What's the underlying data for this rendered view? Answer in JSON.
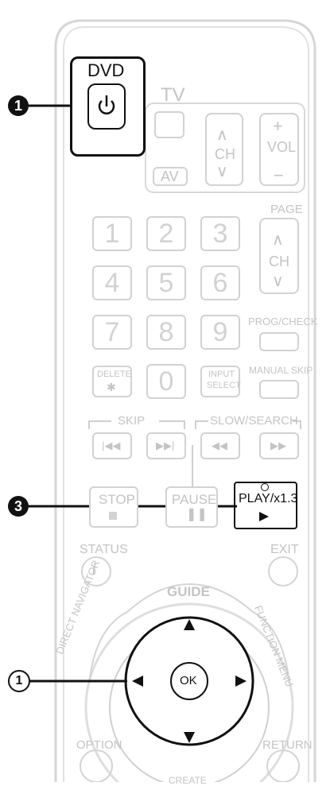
{
  "callouts": {
    "c1": "1",
    "c3": "3",
    "c_circle": "1"
  },
  "dvd": {
    "label": "DVD"
  },
  "tv": {
    "label": "TV",
    "av": "AV",
    "ch": "CH",
    "vol": "VOL",
    "plus": "+",
    "minus": "−"
  },
  "page": {
    "label": "PAGE",
    "ch": "CH"
  },
  "numpad": {
    "n1": "1",
    "n2": "2",
    "n3": "3",
    "n4": "4",
    "n5": "5",
    "n6": "6",
    "n7": "7",
    "n8": "8",
    "n9": "9",
    "n0": "0"
  },
  "labels": {
    "prog_check": "PROG/CHECK",
    "delete": "DELETE",
    "star": "✱",
    "input_select_1": "INPUT",
    "input_select_2": "SELECT",
    "manual_skip": "MANUAL SKIP",
    "skip": "SKIP",
    "slow_search": "SLOW/SEARCH",
    "stop": "STOP",
    "pause": "PAUSE",
    "play": "PLAY/x1.3",
    "status": "STATUS",
    "exit": "EXIT",
    "guide": "GUIDE",
    "direct_navigator": "DIRECT NAVIGATOR",
    "function_menu": "FUNCTION MENU",
    "ok": "OK",
    "option": "OPTION",
    "return": "RETURN",
    "create": "CREATE"
  }
}
